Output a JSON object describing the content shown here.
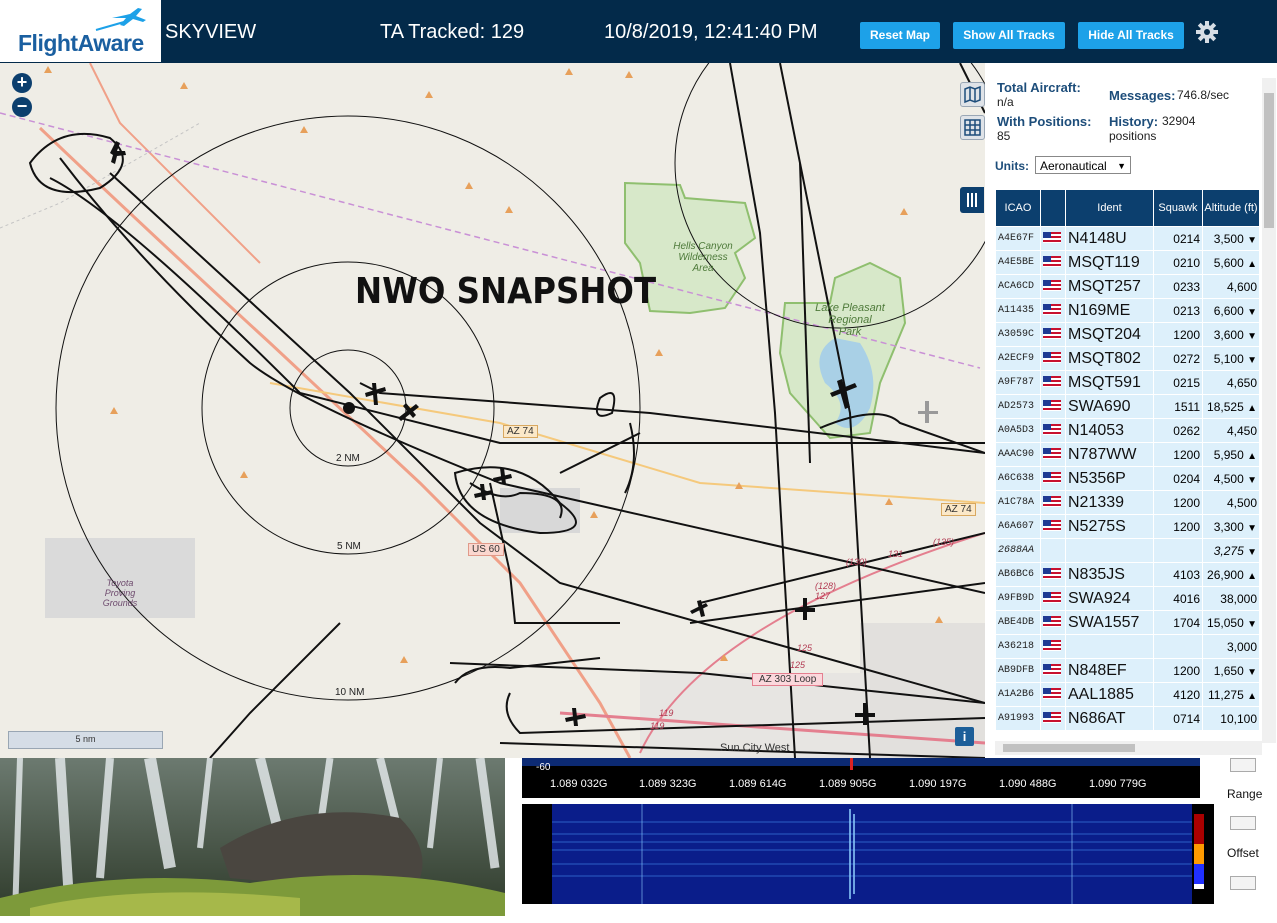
{
  "header": {
    "logo_text": "FlightAware",
    "app_name": "SKYVIEW",
    "tracked": "TA Tracked: 129",
    "datetime": "10/8/2019, 12:41:40 PM",
    "buttons": [
      "Reset Map",
      "Show All Tracks",
      "Hide All Tracks"
    ],
    "settings_icon": "gear-icon",
    "accent": "#1da1e8",
    "bar_color": "#032a4a"
  },
  "map": {
    "overlay_title": "NWO SNAPSHOT",
    "zoom_in": "+",
    "zoom_out": "−",
    "scale": "5 nm",
    "range_rings": [
      "2 NM",
      "5 NM",
      "10 NM"
    ],
    "labels": {
      "wilderness": [
        "Hells Canyon",
        "Wilderness",
        "Area"
      ],
      "park": [
        "Lake Pleasant",
        "Regional",
        "Park"
      ],
      "proving": [
        "Toyota",
        "Proving",
        "Grounds"
      ],
      "az74_a": "AZ 74",
      "az74_b": "AZ 74",
      "us60": "US 60",
      "loop303": "AZ 303 Loop",
      "suncity": "Sun City West",
      "r130": "(130)",
      "r131": "131",
      "r135": "(135)",
      "r128": "(128)",
      "r127": "127",
      "r125a": "125",
      "r125b": "125",
      "r119a": "119",
      "r119b": "119"
    }
  },
  "sidebar": {
    "total_aircraft_label": "Total Aircraft:",
    "total_aircraft_value": "n/a",
    "messages_label": "Messages:",
    "messages_value": "746.8/sec",
    "with_positions_label": "With Positions:",
    "with_positions_value": "85",
    "history_label": "History:",
    "history_value": "32904",
    "history_unit": "positions",
    "units_label": "Units:",
    "units_value": "Aeronautical",
    "columns": [
      "ICAO",
      "",
      "Ident",
      "Squawk",
      "Altitude (ft)"
    ],
    "rows": [
      {
        "icao": "A4E67F",
        "ident": "N4148U",
        "squawk": "0214",
        "alt": "3,500",
        "trend": "▼"
      },
      {
        "icao": "A4E5BE",
        "ident": "MSQT119",
        "squawk": "0210",
        "alt": "5,600",
        "trend": "▲"
      },
      {
        "icao": "ACA6CD",
        "ident": "MSQT257",
        "squawk": "0233",
        "alt": "4,600",
        "trend": ""
      },
      {
        "icao": "A11435",
        "ident": "N169ME",
        "squawk": "0213",
        "alt": "6,600",
        "trend": "▼"
      },
      {
        "icao": "A3059C",
        "ident": "MSQT204",
        "squawk": "1200",
        "alt": "3,600",
        "trend": "▼"
      },
      {
        "icao": "A2ECF9",
        "ident": "MSQT802",
        "squawk": "0272",
        "alt": "5,100",
        "trend": "▼"
      },
      {
        "icao": "A9F787",
        "ident": "MSQT591",
        "squawk": "0215",
        "alt": "4,650",
        "trend": ""
      },
      {
        "icao": "AD2573",
        "ident": "SWA690",
        "squawk": "1511",
        "alt": "18,525",
        "trend": "▲"
      },
      {
        "icao": "A0A5D3",
        "ident": "N14053",
        "squawk": "0262",
        "alt": "4,450",
        "trend": ""
      },
      {
        "icao": "AAAC90",
        "ident": "N787WW",
        "squawk": "1200",
        "alt": "5,950",
        "trend": "▲"
      },
      {
        "icao": "A6C638",
        "ident": "N5356P",
        "squawk": "0204",
        "alt": "4,500",
        "trend": "▼"
      },
      {
        "icao": "A1C78A",
        "ident": "N21339",
        "squawk": "1200",
        "alt": "4,500",
        "trend": ""
      },
      {
        "icao": "A6A607",
        "ident": "N5275S",
        "squawk": "1200",
        "alt": "3,300",
        "trend": "▼"
      },
      {
        "icao": "2688AA",
        "ident": "",
        "squawk": "",
        "alt": "3,275",
        "trend": "▼",
        "highlight": true,
        "noflag": true
      },
      {
        "icao": "AB6BC6",
        "ident": "N835JS",
        "squawk": "4103",
        "alt": "26,900",
        "trend": "▲"
      },
      {
        "icao": "A9FB9D",
        "ident": "SWA924",
        "squawk": "4016",
        "alt": "38,000",
        "trend": ""
      },
      {
        "icao": "ABE4DB",
        "ident": "SWA1557",
        "squawk": "1704",
        "alt": "15,050",
        "trend": "▼"
      },
      {
        "icao": "A36218",
        "ident": "",
        "squawk": "",
        "alt": "3,000",
        "trend": ""
      },
      {
        "icao": "AB9DFB",
        "ident": "N848EF",
        "squawk": "1200",
        "alt": "1,650",
        "trend": "▼"
      },
      {
        "icao": "A1A2B6",
        "ident": "AAL1885",
        "squawk": "4120",
        "alt": "11,275",
        "trend": "▲"
      },
      {
        "icao": "A91993",
        "ident": "N686AT",
        "squawk": "0714",
        "alt": "10,100",
        "trend": ""
      }
    ]
  },
  "spectrum": {
    "db_label": "-60",
    "freqs": [
      "1.089 032G",
      "1.089 323G",
      "1.089 614G",
      "1.089 905G",
      "1.090 197G",
      "1.090 488G",
      "1.090 779G"
    ],
    "range_label": "Range",
    "offset_label": "Offset"
  }
}
